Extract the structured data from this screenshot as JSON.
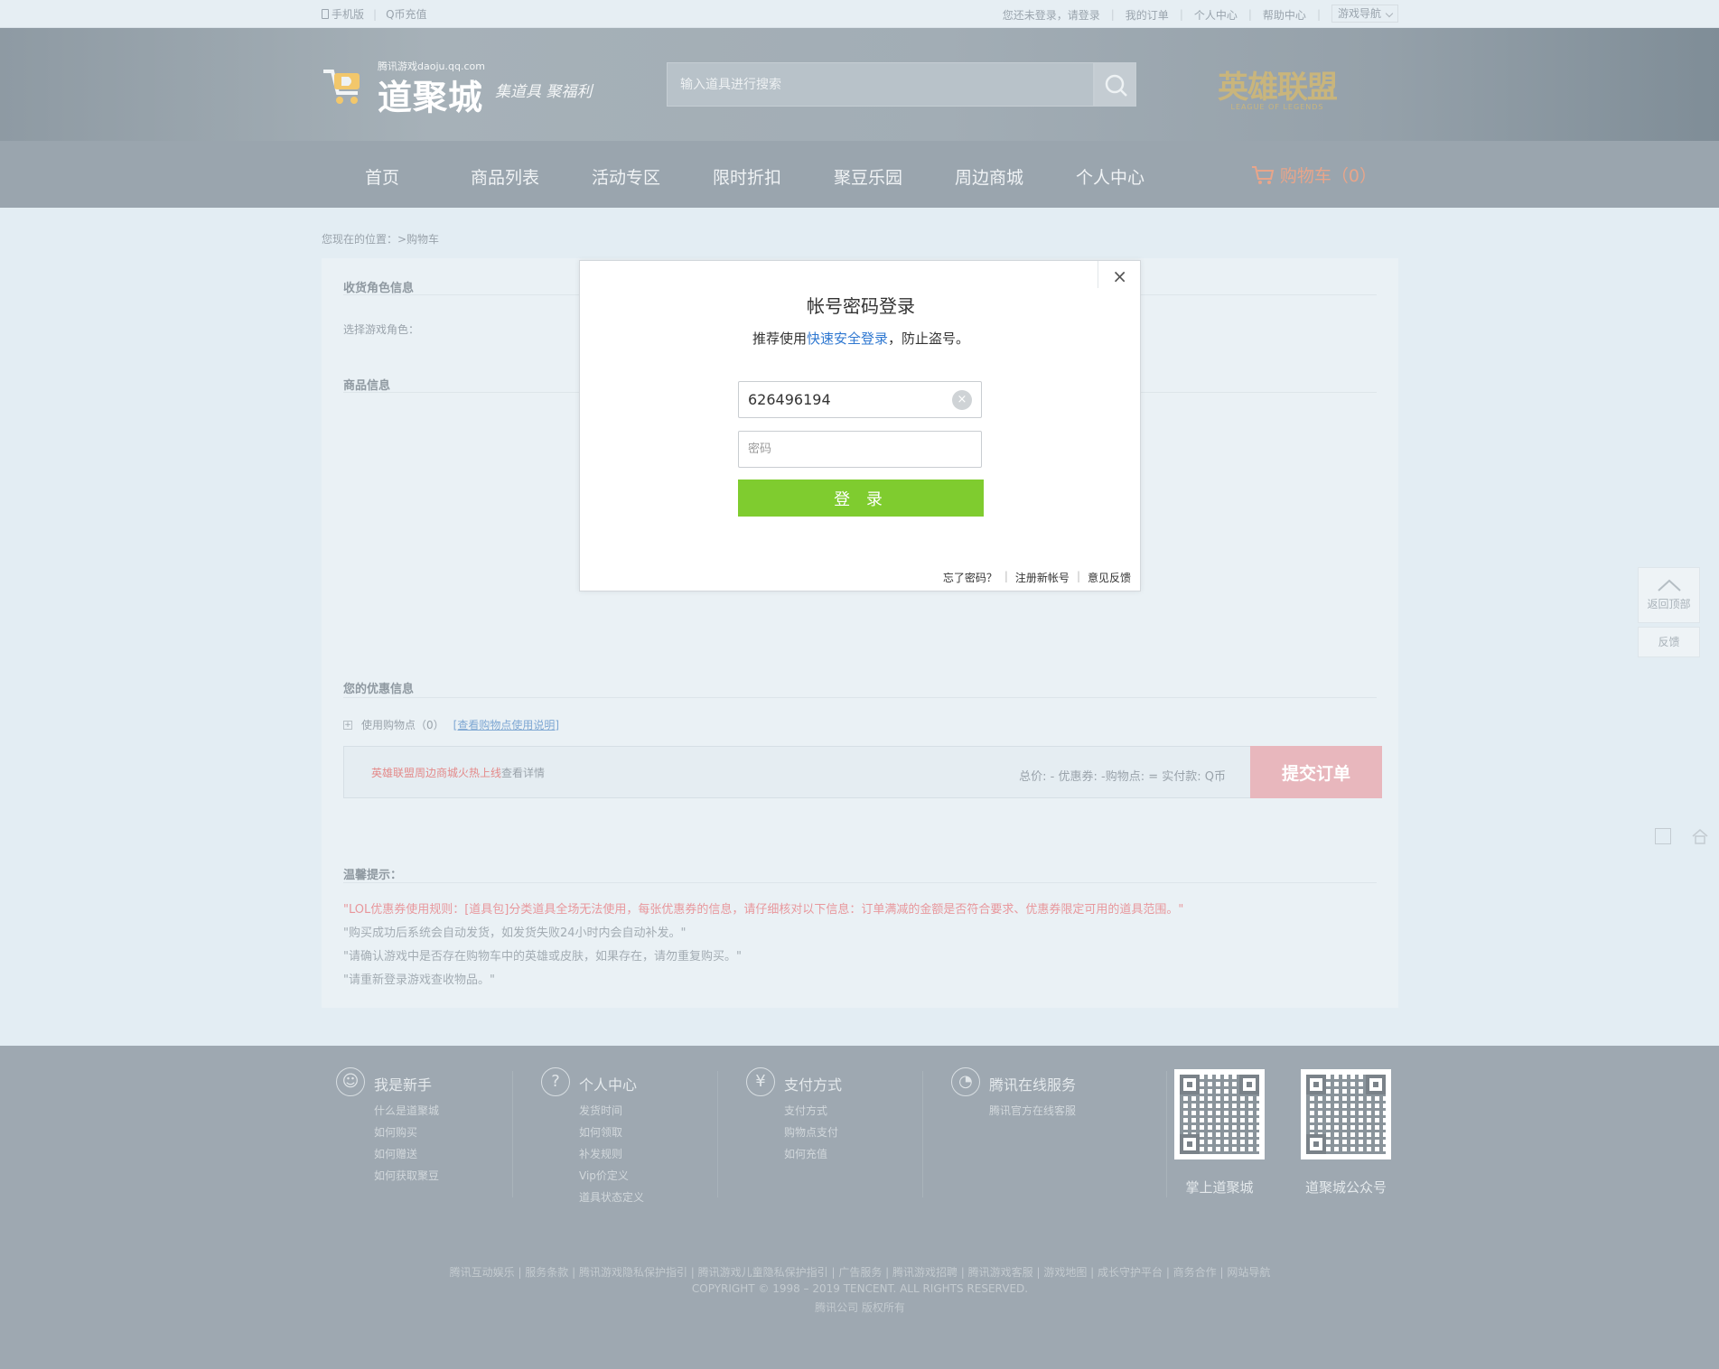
{
  "topbar": {
    "mobile": "手机版",
    "recharge": "Q币充值",
    "login_prompt": "您还未登录，请登录",
    "my_orders": "我的订单",
    "personal_center": "个人中心",
    "help_center": "帮助中心",
    "game_nav": "游戏导航"
  },
  "header": {
    "logo_sub": "腾讯游戏daoju.qq.com",
    "logo_main": "道聚城",
    "slogan": "集道具 聚福利",
    "search_placeholder": "输入道具进行搜索",
    "game_logo_cn": "英雄联盟",
    "game_logo_en": "LEAGUE OF LEGENDS"
  },
  "nav": {
    "items": [
      "首页",
      "商品列表",
      "活动专区",
      "限时折扣",
      "聚豆乐园",
      "周边商城",
      "个人中心"
    ],
    "cart": "购物车（0）"
  },
  "page": {
    "breadcrumb": "您现在的位置：>购物车",
    "role_section": "收货角色信息",
    "choose_role": "选择游戏角色：",
    "goods_section": "商品信息",
    "discount_section": "您的优惠信息",
    "use_points": "使用购物点（0）",
    "points_help": "[查看购物点使用说明]",
    "promo_red": "英雄联盟周边商城火热上线",
    "promo_gray": "查看详情",
    "total": "总价: - 优惠券: -购物点: = 实付款:   Q币",
    "submit": "提交订单",
    "tips_title": "温馨提示：",
    "tips": [
      "\"LOL优惠券使用规则：[道具包]分类道具全场无法使用，每张优惠券的信息，请仔细核对以下信息：订单满减的金额是否符合要求、优惠券限定可用的道具范围。\"",
      "\"购买成功后系统会自动发货，如发货失败24小时内会自动补发。\"",
      "\"请确认游戏中是否存在购物车中的英雄或皮肤，如果存在，请勿重复购买。\"",
      "\"请重新登录游戏查收物品。\""
    ]
  },
  "side": {
    "back_top": "返回顶部",
    "feedback": "反馈"
  },
  "footer": {
    "cols": [
      {
        "icon": "person-icon",
        "title": "我是新手",
        "links": [
          "什么是道聚城",
          "如何购买",
          "如何赠送",
          "如何获取聚豆"
        ]
      },
      {
        "icon": "question-icon",
        "title": "个人中心",
        "links": [
          "发货时间",
          "如何领取",
          "补发规则",
          "Vip价定义",
          "道具状态定义"
        ]
      },
      {
        "icon": "yen-icon",
        "title": "支付方式",
        "links": [
          "支付方式",
          "购物点支付",
          "如何充值"
        ]
      },
      {
        "icon": "service-icon",
        "title": "腾讯在线服务",
        "links": [
          "腾讯官方在线客服"
        ]
      }
    ],
    "qr1": "掌上道聚城",
    "qr2": "道聚城公众号",
    "links_line": "腾讯互动娱乐 | 服务条款 | 腾讯游戏隐私保护指引 | 腾讯游戏儿童隐私保护指引 | 广告服务 | 腾讯游戏招聘 | 腾讯游戏客服 | 游戏地图 | 成长守护平台 | 商务合作 | 网站导航",
    "copyright": "COPYRIGHT © 1998 – 2019 TENCENT. ALL RIGHTS RESERVED.",
    "rights": "腾讯公司 版权所有"
  },
  "dialog": {
    "title": "帐号密码登录",
    "sub_prefix": "推荐使用",
    "sub_link": "快速安全登录",
    "sub_suffix": "，防止盗号。",
    "account_value": "626496194",
    "password_placeholder": "密码",
    "login_button": "登 录",
    "forgot": "忘了密码？",
    "register": "注册新帐号",
    "feedback": "意见反馈"
  }
}
